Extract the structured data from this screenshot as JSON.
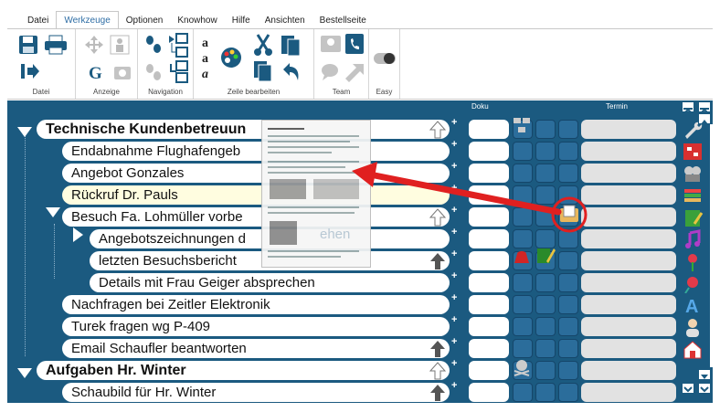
{
  "menu": {
    "items": [
      "Datei",
      "Werkzeuge",
      "Optionen",
      "Knowhow",
      "Hilfe",
      "Ansichten",
      "Bestellseite"
    ],
    "active": "Werkzeuge"
  },
  "ribbon": {
    "groups": [
      "Datei",
      "Anzeige",
      "Navigation",
      "Zeile bearbeiten",
      "Team",
      "Easy"
    ]
  },
  "columns": {
    "doku": "Doku",
    "termin": "Termin"
  },
  "rows": [
    {
      "label": "Technische Kundenbetreuun"
    },
    {
      "label": "Endabnahme Flughafengeb"
    },
    {
      "label": "Angebot Gonzales"
    },
    {
      "label": "Rückruf Dr. Pauls"
    },
    {
      "label": "Besuch Fa. Lohmüller vorbe"
    },
    {
      "label": "Angebotszeichnungen d"
    },
    {
      "label": "letzten Besuchsbericht"
    },
    {
      "label": "Details mit Frau Geiger absprechen"
    },
    {
      "label": "Nachfragen bei Zeitler Elektronik"
    },
    {
      "label": "Turek fragen wg P-409"
    },
    {
      "label": "Email Schaufler beantworten"
    },
    {
      "label": "Aufgaben Hr. Winter"
    },
    {
      "label": "Schaubild für Hr. Winter"
    }
  ],
  "overlay": {
    "drag_ghost_text": "ehen"
  },
  "colors": {
    "panel": "#1b5a80",
    "accent": "#2f6ea5",
    "arrow": "#e02020"
  }
}
